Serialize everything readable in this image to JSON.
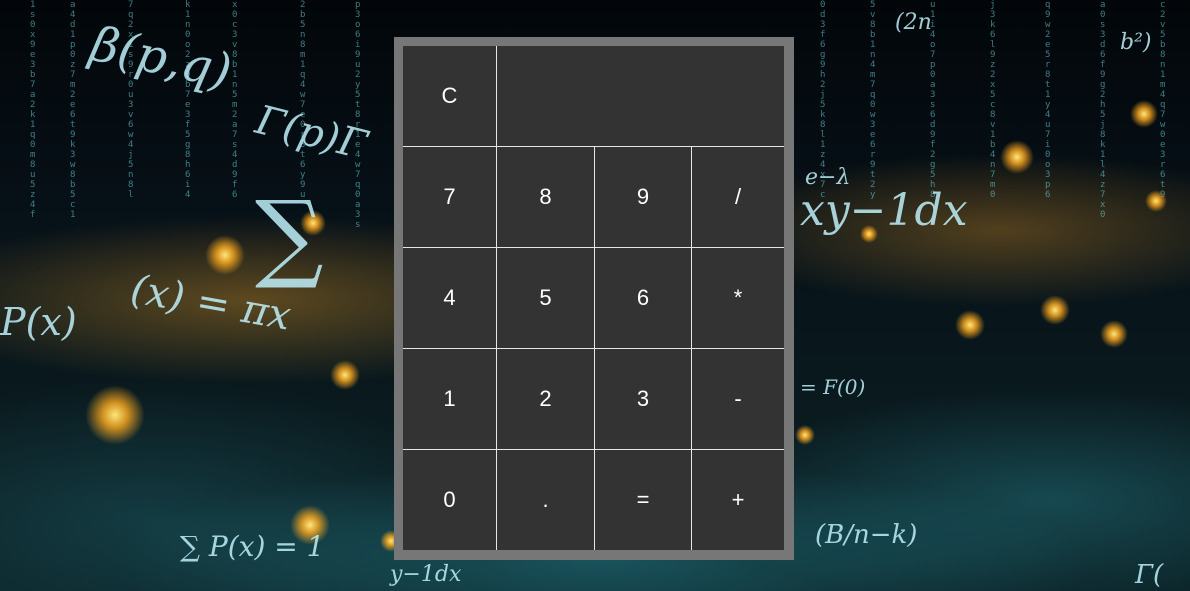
{
  "calculator": {
    "clear_label": "C",
    "display_value": "",
    "keys": {
      "seven": "7",
      "eight": "8",
      "nine": "9",
      "divide": "/",
      "four": "4",
      "five": "5",
      "six": "6",
      "multiply": "*",
      "one": "1",
      "two": "2",
      "three": "3",
      "subtract": "-",
      "zero": "0",
      "decimal": ".",
      "equals": "=",
      "add": "+"
    }
  },
  "background": {
    "formulas": {
      "beta": "β(p,q)",
      "gamma_top": "Γ(p)Γ",
      "sum": "∑",
      "integral_right": "xy−1dx",
      "pi_x": "(x) = πx",
      "p_x_left": "P(x)",
      "equals_f": "= F(0)",
      "sum_bottom": "∑ P(x) = 1",
      "integral_bottom": "y−1dx",
      "gamma_bottom": "Γ(",
      "fraction": "(B/n−k)",
      "e_lambda": "e−λ",
      "two_n": "(2n",
      "b_squared": "b²)"
    }
  }
}
